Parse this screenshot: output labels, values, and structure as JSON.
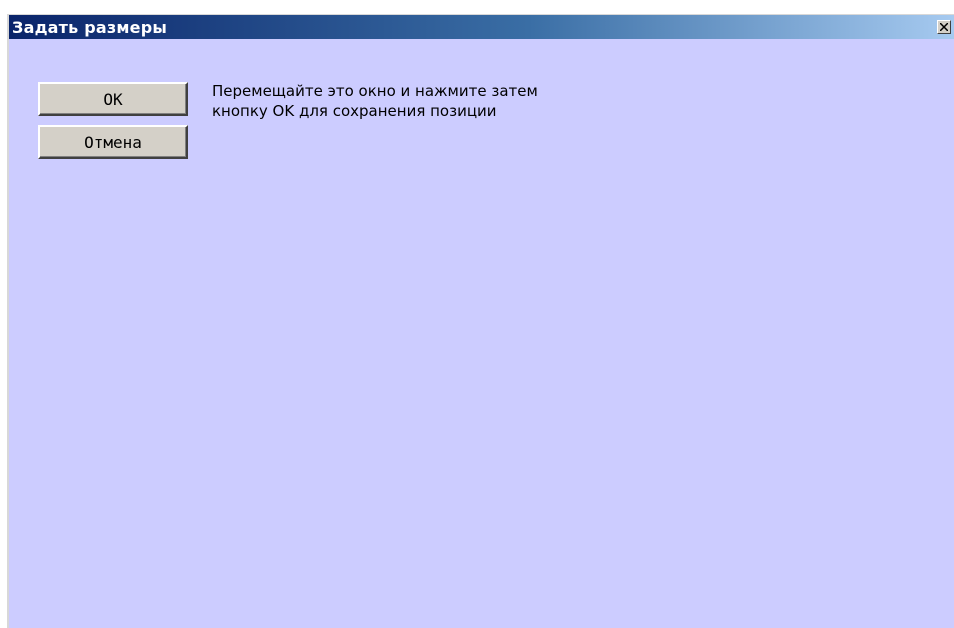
{
  "window": {
    "title": "Задать размеры",
    "close_icon": "close-icon"
  },
  "buttons": {
    "ok_label": "OK",
    "cancel_label": "Отмена"
  },
  "message": {
    "line1": "Перемещайте это окно и нажмите затем",
    "line2": "кнопку OK для сохранения позиции"
  },
  "colors": {
    "background": "#ccccff",
    "title_gradient_start": "#0a246a",
    "title_gradient_end": "#a6caf0",
    "button_face": "#d4d0c8"
  }
}
